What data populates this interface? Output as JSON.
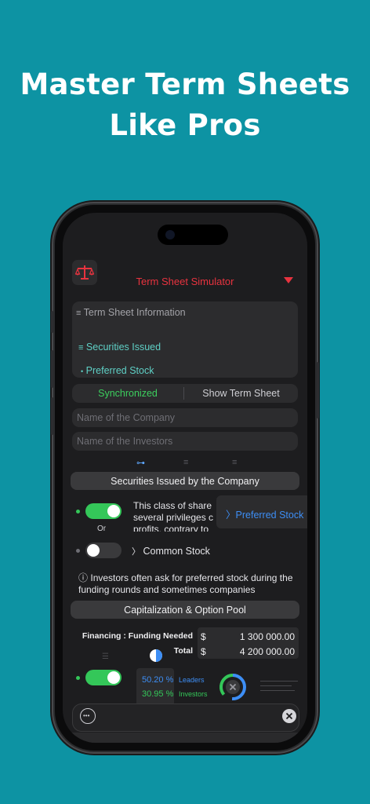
{
  "headline": {
    "line1": "Master Term Sheets",
    "line2": "Like Pros"
  },
  "app": {
    "title": "Term Sheet Simulator",
    "info_title": "Term Sheet Information",
    "securities_issued": "Securities Issued",
    "preferred_stock": "Preferred Stock",
    "tabs": {
      "synchronized": "Synchronized",
      "show_term_sheet": "Show Term Sheet"
    },
    "company_placeholder": "Name of the Company",
    "investors_placeholder": "Name of the Investors",
    "section_securities": "Securities Issued by the Company",
    "pref_description": "This class of share several privileges c profits, contrary to",
    "or_label": "Or",
    "pref_option": "Preferred Stock",
    "common_option": "Common Stock",
    "note": "Investors often ask for preferred stock during the funding rounds and sometimes companies",
    "section_cap": "Capitalization & Option Pool",
    "financing_label": "Financing : Funding Needed",
    "total_label": "Total",
    "currency": "$",
    "funding_needed": "1 300 000.00",
    "total": "4 200 000.00",
    "pct_leaders": "50.20 %",
    "pct_investors": "30.95 %",
    "leaders_label": "Leaders",
    "investors_label": "Investors"
  },
  "colors": {
    "background": "#0d93a3",
    "accent_red": "#e8333f",
    "teal": "#5fd0c6",
    "green": "#34c759",
    "blue": "#3d8ef5"
  }
}
